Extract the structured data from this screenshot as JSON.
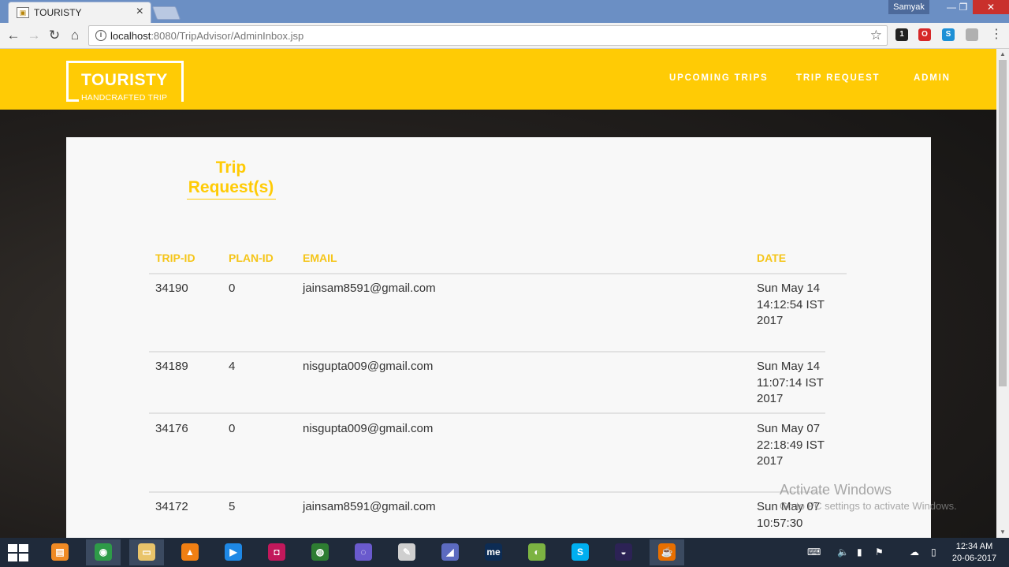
{
  "browser": {
    "tab_title": "TOURISTY",
    "tab_close": "×",
    "profile_name": "Samyak",
    "url_host": "localhost",
    "url_path": ":8080/TripAdvisor/AdminInbox.jsp",
    "window_controls": {
      "minimize": "—",
      "restore": "❐",
      "close": "✕"
    },
    "nav": {
      "back": "←",
      "forward": "→",
      "reload": "↻",
      "home": "⌂"
    },
    "star": "☆",
    "menu": "⋮",
    "extensions": [
      {
        "name": "extension-badge-icon",
        "label": "1",
        "color": "#222222"
      },
      {
        "name": "opera-icon",
        "label": "O",
        "color": "#d62828"
      },
      {
        "name": "skype-extension-icon",
        "label": "S",
        "color": "#1e90d6"
      },
      {
        "name": "extension-puzzle-icon",
        "label": "",
        "color": "#b0b0b0"
      }
    ]
  },
  "site": {
    "brand": "TOURISTY",
    "tagline": "HANDCRAFTED TRIP",
    "nav": [
      "UPCOMING TRIPS",
      "TRIP REQUEST",
      "ADMIN"
    ],
    "accent_color": "#ffcb05"
  },
  "page": {
    "heading": "Trip Request(s)",
    "columns": {
      "trip_id": "TRIP-ID",
      "plan_id": "PLAN-ID",
      "email": "EMAIL",
      "date": "DATE"
    },
    "rows": [
      {
        "trip_id": "34190",
        "plan_id": "0",
        "email": "jainsam8591@gmail.com",
        "date": "Sun May 14 14:12:54 IST 2017"
      },
      {
        "trip_id": "34189",
        "plan_id": "4",
        "email": "nisgupta009@gmail.com",
        "date": "Sun May 14 11:07:14 IST 2017"
      },
      {
        "trip_id": "34176",
        "plan_id": "0",
        "email": "nisgupta009@gmail.com",
        "date": "Sun May 07 22:18:49 IST 2017"
      },
      {
        "trip_id": "34172",
        "plan_id": "5",
        "email": "jainsam8591@gmail.com",
        "date": "Sun May 07 10:57:30"
      }
    ]
  },
  "watermark": {
    "line1": "Activate Windows",
    "line2": "Go to PC settings to activate Windows."
  },
  "taskbar": {
    "apps": [
      {
        "name": "server-manager-icon",
        "label": "▤",
        "color": "#f08a24",
        "active": false
      },
      {
        "name": "chrome-icon",
        "label": "◉",
        "color": "#2e9b48",
        "active": true
      },
      {
        "name": "file-explorer-icon",
        "label": "▭",
        "color": "#e9c46a",
        "active": true
      },
      {
        "name": "vlc-icon",
        "label": "▲",
        "color": "#f07f13",
        "active": false
      },
      {
        "name": "media-player-icon",
        "label": "▶",
        "color": "#1e88e5",
        "active": false
      },
      {
        "name": "screen-recorder-icon",
        "label": "◘",
        "color": "#c2185b",
        "active": false
      },
      {
        "name": "globe-app-icon",
        "label": "◍",
        "color": "#2e7d32",
        "active": false
      },
      {
        "name": "torrent-icon",
        "label": "◌",
        "color": "#6a5acd",
        "active": false
      },
      {
        "name": "notepad-icon",
        "label": "✎",
        "color": "#cfcfcf",
        "active": false
      },
      {
        "name": "dolphin-app-icon",
        "label": "◢",
        "color": "#5c6bc0",
        "active": false
      },
      {
        "name": "me-app-icon",
        "label": "me",
        "color": "#0d2c54",
        "active": false
      },
      {
        "name": "green-app-icon",
        "label": "◐",
        "color": "#7cb342",
        "active": false
      },
      {
        "name": "skype-icon",
        "label": "S",
        "color": "#00aff0",
        "active": false
      },
      {
        "name": "eclipse-icon",
        "label": "◒",
        "color": "#2c2255",
        "active": false
      },
      {
        "name": "java-icon",
        "label": "☕",
        "color": "#e76f00",
        "active": true
      }
    ],
    "tray": {
      "keyboard": "⌨",
      "volume": "🔈",
      "network": "▮",
      "flag": "⚑",
      "cloud": "☁",
      "battery": "▯"
    },
    "time": "12:34 AM",
    "date": "20-06-2017"
  }
}
